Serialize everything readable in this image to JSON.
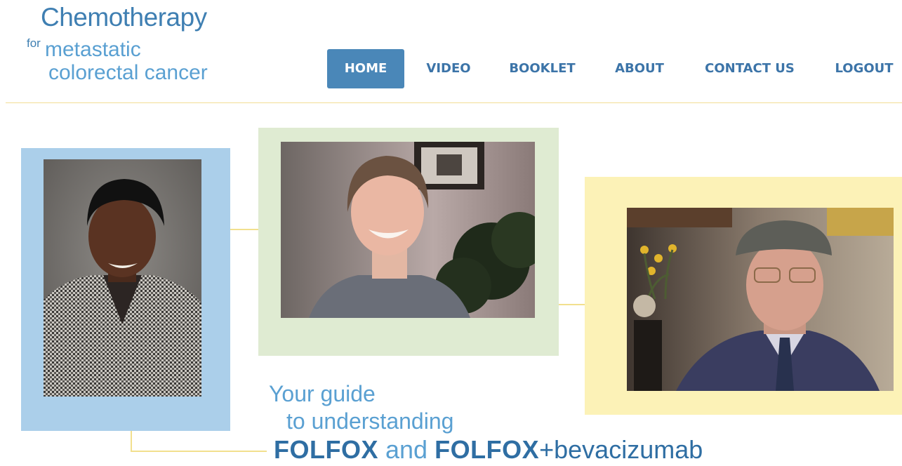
{
  "logo": {
    "line1": "Chemotherapy",
    "for": "for",
    "line2": "metastatic",
    "line3": "colorectal cancer"
  },
  "nav": {
    "active": "HOME",
    "items": [
      {
        "label": "HOME"
      },
      {
        "label": "VIDEO"
      },
      {
        "label": "BOOKLET"
      },
      {
        "label": "ABOUT"
      },
      {
        "label": "CONTACT US"
      },
      {
        "label": "LOGOUT"
      }
    ]
  },
  "tagline": {
    "line1": "Your guide",
    "line2": "to understanding",
    "drug1": "FOLFOX",
    "and": "and",
    "drug2": "FOLFOX",
    "plus": "+",
    "drug3": "bevacizumab"
  },
  "colors": {
    "accent": "#4a87b8",
    "frame_blue": "#abcfea",
    "frame_green": "#dfebd2",
    "frame_yellow": "#fcf2b7",
    "rule": "#f3de95"
  }
}
